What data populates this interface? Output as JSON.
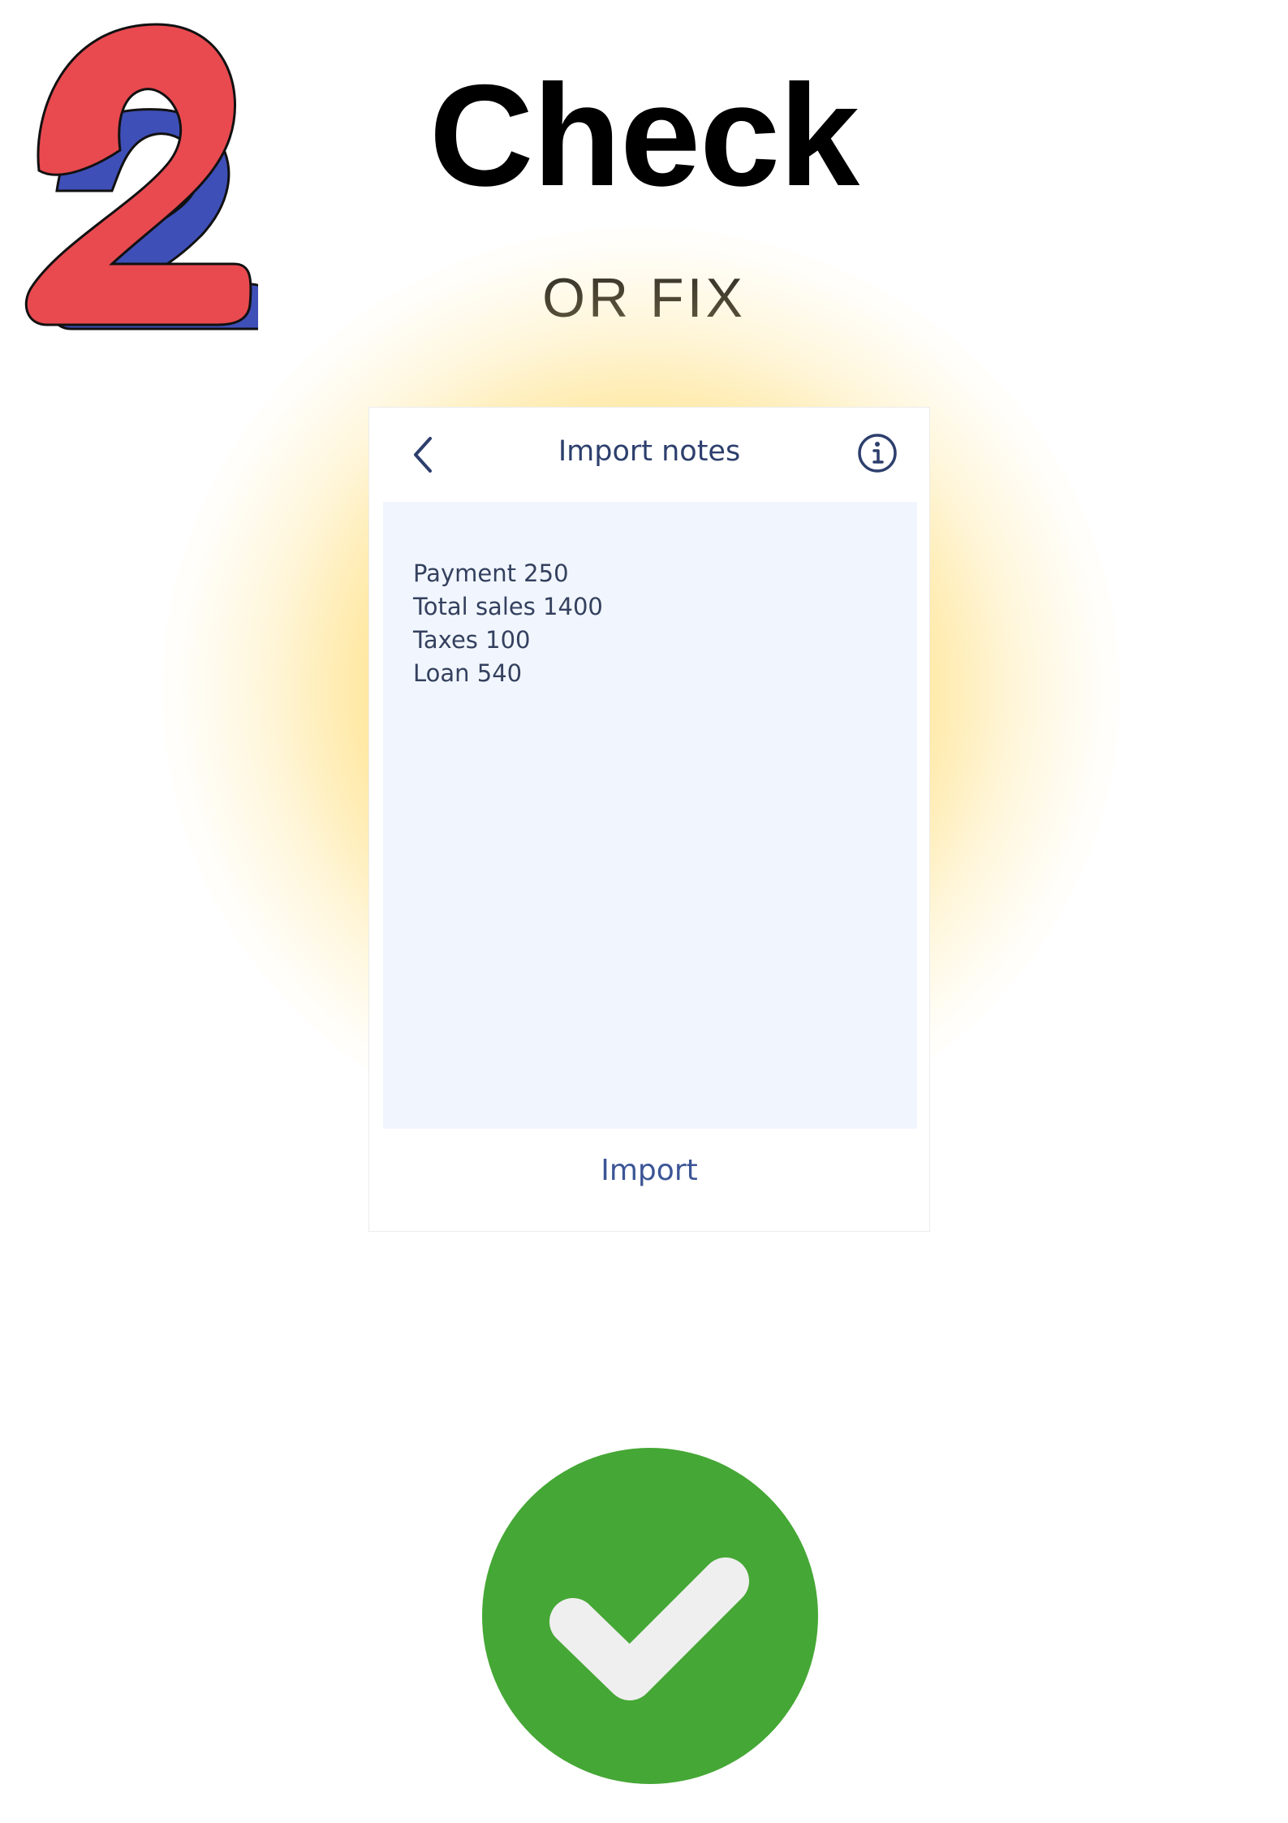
{
  "step": {
    "number": "2",
    "colors": {
      "fill": "#e84a50",
      "shadow": "#3f4fb8",
      "outline": "#111111"
    }
  },
  "heading": {
    "title": "Check",
    "subtitle": "OR FIX"
  },
  "app": {
    "header": {
      "back_icon": "chevron-left-icon",
      "title": "Import notes",
      "info_icon": "info-icon"
    },
    "notes": {
      "lines": [
        "Payment 250",
        "Total sales 1400",
        "Taxes 100",
        "Loan 540"
      ]
    },
    "import_label": "Import",
    "colors": {
      "text": "#2d3f6d",
      "notes_bg": "#f1f6fe",
      "action": "#3c5596"
    }
  },
  "confirm": {
    "icon": "check-icon",
    "colors": {
      "badge": "#45a735",
      "mark": "#efefef"
    }
  }
}
